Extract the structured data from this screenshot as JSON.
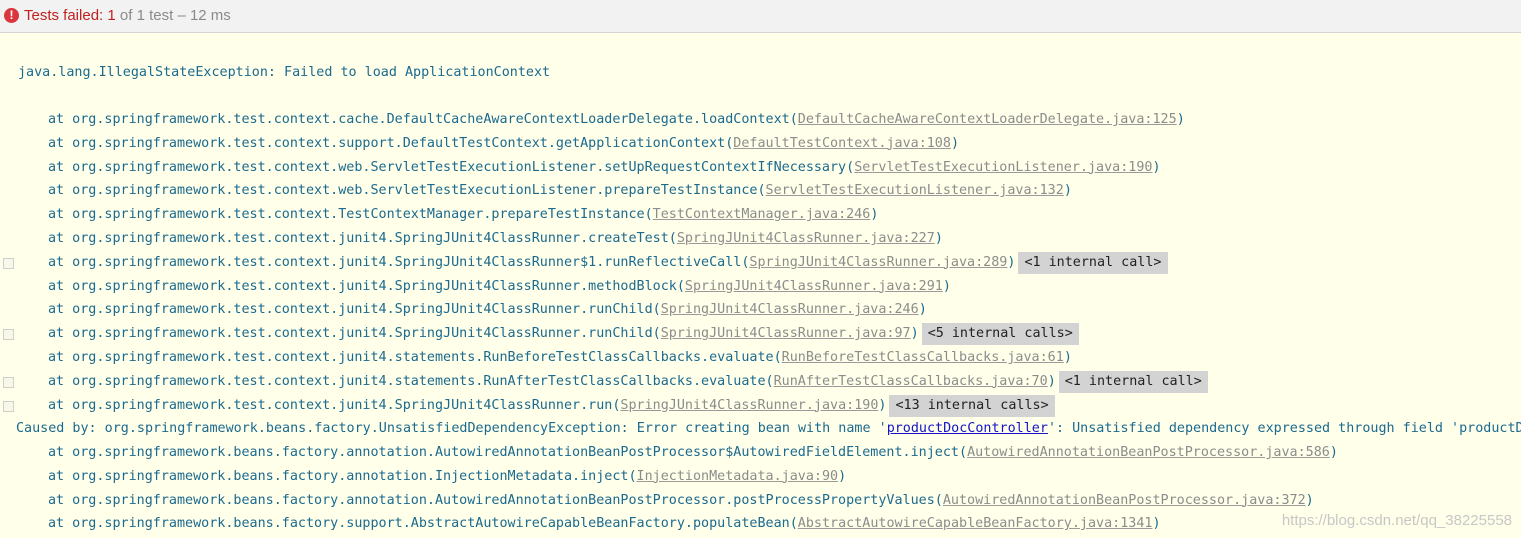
{
  "status": {
    "label": "Tests failed:",
    "failed": "1",
    "rest": "of 1 test – 12 ms",
    "icon": "error-icon",
    "icon_glyph": "!"
  },
  "colors": {
    "failed": "#c02020",
    "trace_text": "#1b6a8f",
    "source_link": "#8c8c8c",
    "bean_link": "#1515c8",
    "background": "#ffffea",
    "badge": "#d3d3d3"
  },
  "console": {
    "exception": "java.lang.IllegalStateException: Failed to load ApplicationContext",
    "frames": [
      {
        "text": "at org.springframework.test.context.cache.DefaultCacheAwareContextLoaderDelegate.loadContext(",
        "link": "DefaultCacheAwareContextLoaderDelegate.java:125",
        "close": ")",
        "badge": ""
      },
      {
        "text": "at org.springframework.test.context.support.DefaultTestContext.getApplicationContext(",
        "link": "DefaultTestContext.java:108",
        "close": ")",
        "badge": ""
      },
      {
        "text": "at org.springframework.test.context.web.ServletTestExecutionListener.setUpRequestContextIfNecessary(",
        "link": "ServletTestExecutionListener.java:190",
        "close": ")",
        "badge": ""
      },
      {
        "text": "at org.springframework.test.context.web.ServletTestExecutionListener.prepareTestInstance(",
        "link": "ServletTestExecutionListener.java:132",
        "close": ")",
        "badge": ""
      },
      {
        "text": "at org.springframework.test.context.TestContextManager.prepareTestInstance(",
        "link": "TestContextManager.java:246",
        "close": ")",
        "badge": ""
      },
      {
        "text": "at org.springframework.test.context.junit4.SpringJUnit4ClassRunner.createTest(",
        "link": "SpringJUnit4ClassRunner.java:227",
        "close": ")",
        "badge": ""
      },
      {
        "text": "at org.springframework.test.context.junit4.SpringJUnit4ClassRunner$1.runReflectiveCall(",
        "link": "SpringJUnit4ClassRunner.java:289",
        "close": ")",
        "badge": "<1 internal call>"
      },
      {
        "text": "at org.springframework.test.context.junit4.SpringJUnit4ClassRunner.methodBlock(",
        "link": "SpringJUnit4ClassRunner.java:291",
        "close": ")",
        "badge": ""
      },
      {
        "text": "at org.springframework.test.context.junit4.SpringJUnit4ClassRunner.runChild(",
        "link": "SpringJUnit4ClassRunner.java:246",
        "close": ")",
        "badge": ""
      },
      {
        "text": "at org.springframework.test.context.junit4.SpringJUnit4ClassRunner.runChild(",
        "link": "SpringJUnit4ClassRunner.java:97",
        "close": ")",
        "badge": "<5 internal calls>"
      },
      {
        "text": "at org.springframework.test.context.junit4.statements.RunBeforeTestClassCallbacks.evaluate(",
        "link": "RunBeforeTestClassCallbacks.java:61",
        "close": ")",
        "badge": ""
      },
      {
        "text": "at org.springframework.test.context.junit4.statements.RunAfterTestClassCallbacks.evaluate(",
        "link": "RunAfterTestClassCallbacks.java:70",
        "close": ")",
        "badge": "<1 internal call>"
      },
      {
        "text": "at org.springframework.test.context.junit4.SpringJUnit4ClassRunner.run(",
        "link": "SpringJUnit4ClassRunner.java:190",
        "close": ")",
        "badge": "<13 internal calls>"
      }
    ],
    "caused": {
      "prefix": "Caused by: org.springframework.beans.factory.UnsatisfiedDependencyException: Error creating bean with name '",
      "link": "productDocController",
      "suffix": "': Unsatisfied dependency expressed through field 'productDoc"
    },
    "caused_frames": [
      {
        "text": "at org.springframework.beans.factory.annotation.AutowiredAnnotationBeanPostProcessor$AutowiredFieldElement.inject(",
        "link": "AutowiredAnnotationBeanPostProcessor.java:586",
        "close": ")",
        "badge": ""
      },
      {
        "text": "at org.springframework.beans.factory.annotation.InjectionMetadata.inject(",
        "link": "InjectionMetadata.java:90",
        "close": ")",
        "badge": ""
      },
      {
        "text": "at org.springframework.beans.factory.annotation.AutowiredAnnotationBeanPostProcessor.postProcessPropertyValues(",
        "link": "AutowiredAnnotationBeanPostProcessor.java:372",
        "close": ")",
        "badge": ""
      },
      {
        "text": "at org.springframework.beans.factory.support.AbstractAutowireCapableBeanFactory.populateBean(",
        "link": "AbstractAutowireCapableBeanFactory.java:1341",
        "close": ")",
        "badge": ""
      }
    ]
  },
  "watermark": "https://blog.csdn.net/qq_38225558"
}
